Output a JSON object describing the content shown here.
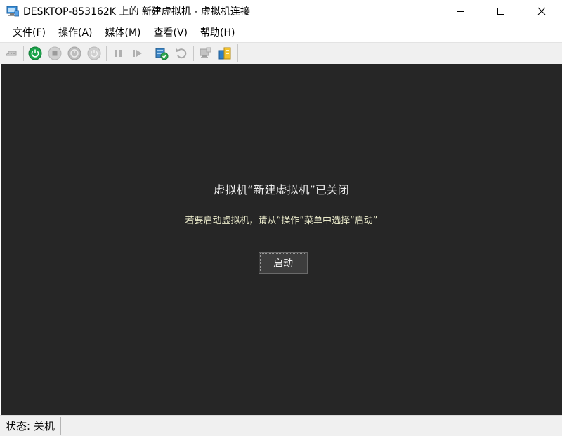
{
  "window": {
    "title": "DESKTOP-853162K 上的 新建虚拟机 - 虚拟机连接",
    "icon": "vm-connection-icon"
  },
  "window_controls": {
    "minimize": "minimize-icon",
    "maximize": "maximize-icon",
    "close": "close-icon"
  },
  "menu": {
    "items": [
      {
        "label": "文件(F)"
      },
      {
        "label": "操作(A)"
      },
      {
        "label": "媒体(M)"
      },
      {
        "label": "查看(V)"
      },
      {
        "label": "帮助(H)"
      }
    ]
  },
  "toolbar": {
    "buttons": [
      {
        "icon": "ctrl-alt-del-icon",
        "enabled": false
      },
      {
        "icon": "power-on-icon",
        "enabled": true,
        "color": "#1aa34a"
      },
      {
        "icon": "turn-off-icon",
        "enabled": false
      },
      {
        "icon": "shut-down-icon",
        "enabled": false
      },
      {
        "icon": "power-button-icon",
        "enabled": false
      },
      {
        "icon": "pause-icon",
        "enabled": false
      },
      {
        "icon": "resume-icon",
        "enabled": false
      },
      {
        "icon": "checkpoint-icon",
        "enabled": true
      },
      {
        "icon": "revert-icon",
        "enabled": false
      },
      {
        "icon": "enhanced-session-icon",
        "enabled": false
      },
      {
        "icon": "share-icon",
        "enabled": true
      }
    ]
  },
  "content": {
    "heading": "虚拟机“新建虚拟机”已关闭",
    "instruction": "若要启动虚拟机，请从“操作”菜单中选择“启动”",
    "start_button": "启动",
    "background": "#262626"
  },
  "status": {
    "text": "状态: 关机"
  }
}
